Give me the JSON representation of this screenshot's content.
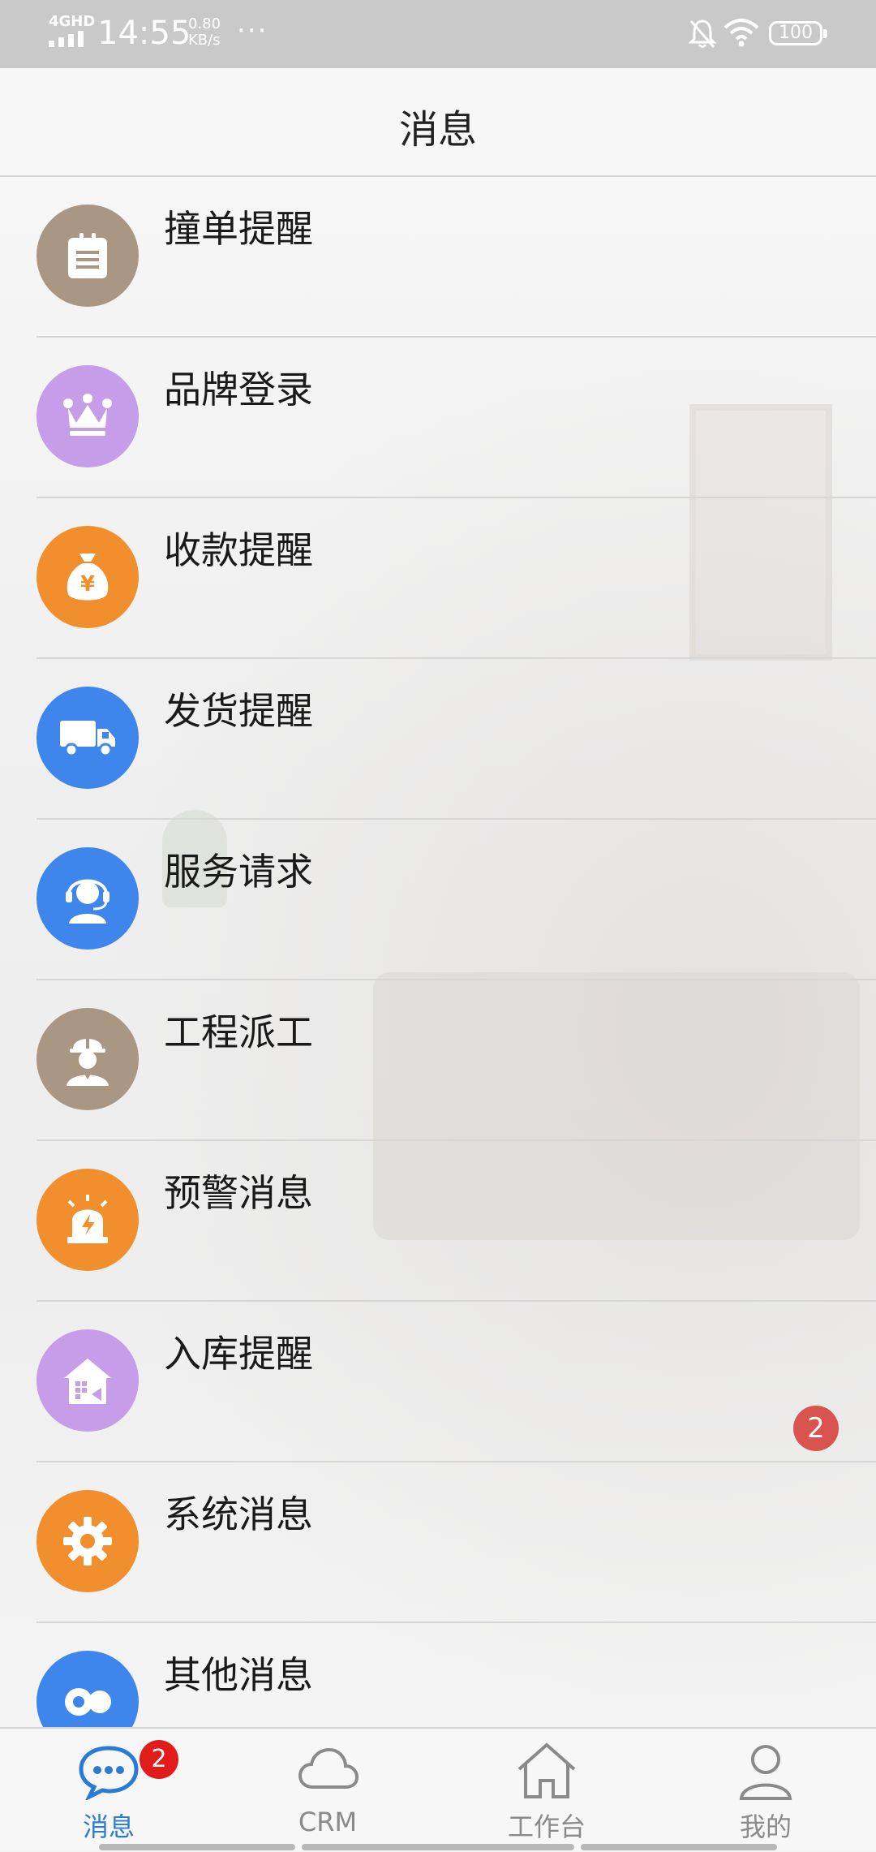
{
  "status_bar": {
    "network": "4GHD",
    "time": "14:55",
    "speed_value": "0.80",
    "speed_unit": "KB/s",
    "more_dots": "···",
    "battery": "100"
  },
  "header": {
    "title": "消息"
  },
  "list": [
    {
      "label": "撞单提醒",
      "icon": "clipboard-icon",
      "color": "#a99683"
    },
    {
      "label": "品牌登录",
      "icon": "crown-icon",
      "color": "#c69de8"
    },
    {
      "label": "收款提醒",
      "icon": "money-bag-icon",
      "color": "#f18f2f"
    },
    {
      "label": "发货提醒",
      "icon": "truck-icon",
      "color": "#3f86ec"
    },
    {
      "label": "服务请求",
      "icon": "headset-agent-icon",
      "color": "#3f86ec"
    },
    {
      "label": "工程派工",
      "icon": "worker-helmet-icon",
      "color": "#a99683"
    },
    {
      "label": "预警消息",
      "icon": "alarm-siren-icon",
      "color": "#f18f2f"
    },
    {
      "label": "入库提醒",
      "icon": "warehouse-in-icon",
      "color": "#c69de8",
      "badge": "2"
    },
    {
      "label": "系统消息",
      "icon": "gear-icon",
      "color": "#f18f2f"
    },
    {
      "label": "其他消息",
      "icon": "bubbles-icon",
      "color": "#3f86ec"
    }
  ],
  "bottom_nav": {
    "items": [
      {
        "label": "消息",
        "icon": "chat-bubble-icon",
        "active": true,
        "badge": "2"
      },
      {
        "label": "CRM",
        "icon": "cloud-icon",
        "active": false
      },
      {
        "label": "工作台",
        "icon": "home-icon",
        "active": false
      },
      {
        "label": "我的",
        "icon": "person-icon",
        "active": false
      }
    ]
  }
}
